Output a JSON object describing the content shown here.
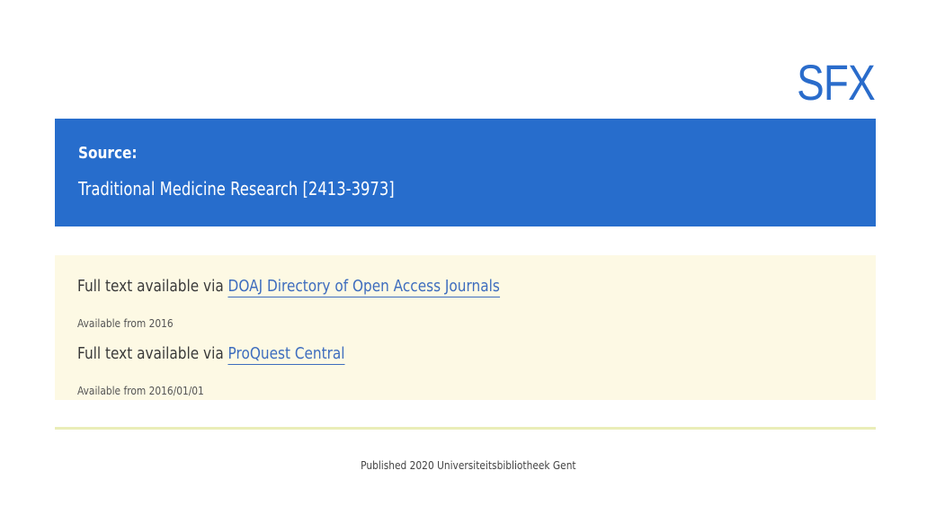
{
  "header": {
    "logo_text": "SFX"
  },
  "source": {
    "label": "Source:",
    "title": "Traditional Medicine Research [2413-3973]"
  },
  "results": [
    {
      "prefix": "Full text available via ",
      "link_text": "DOAJ Directory of Open Access Journals",
      "availability": "Available from 2016"
    },
    {
      "prefix": "Full text available via ",
      "link_text": "ProQuest Central",
      "availability": "Available from 2016/01/01"
    }
  ],
  "footer": {
    "text": "Published 2020 Universiteitsbibliotheek Gent"
  },
  "colors": {
    "brand_blue": "#276dcc",
    "link_blue": "#3e6dbe",
    "results_background": "#fdf9e4",
    "divider": "#eaedb8"
  }
}
